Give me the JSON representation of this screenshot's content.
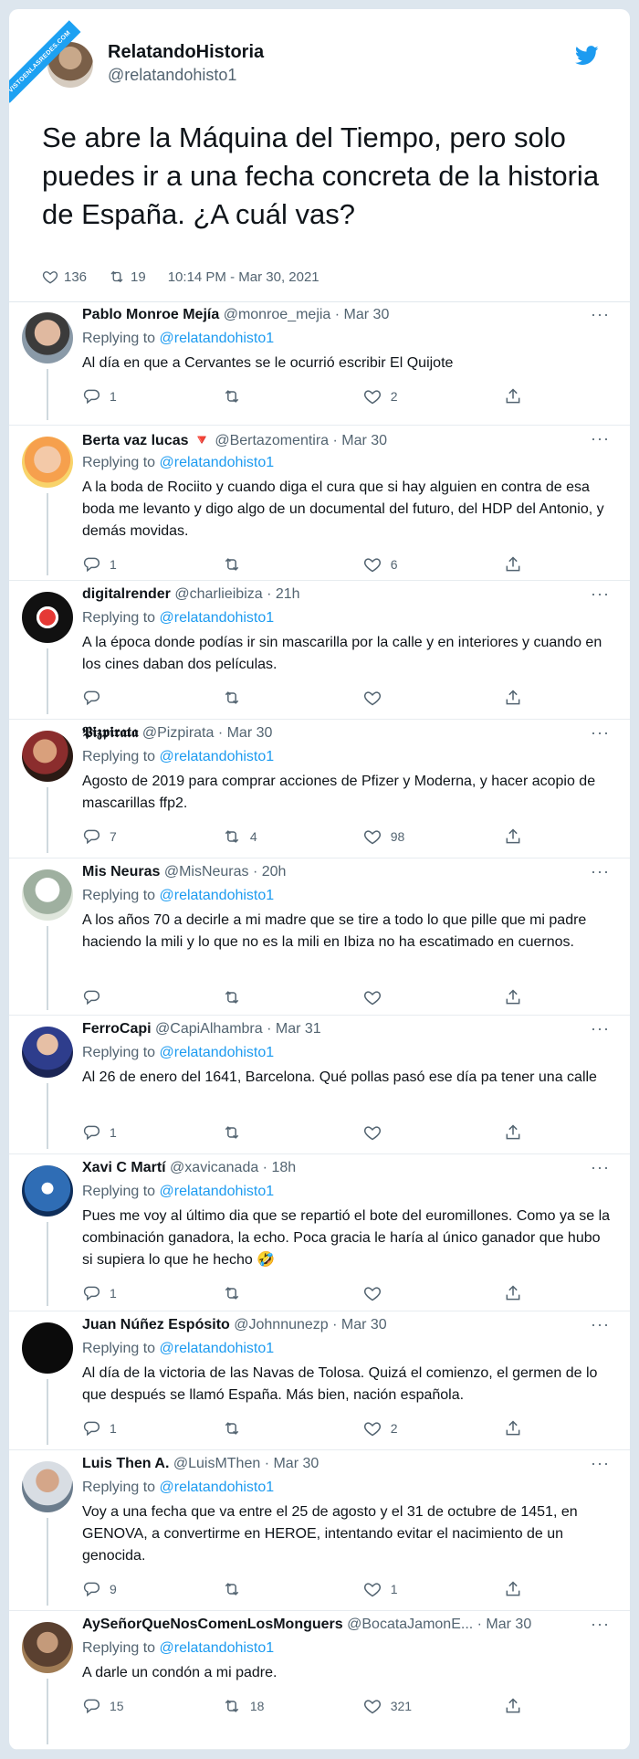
{
  "watermark": "VISTOENLASREDES.COM",
  "tweet": {
    "author_name": "RelatandoHistoria",
    "author_handle": "@relatandohisto1",
    "text": "Se abre la Máquina del Tiempo, pero solo puedes ir a una fecha concreta de la historia de España. ¿A cuál vas?",
    "likes": "136",
    "retweets": "19",
    "timestamp": "10:14 PM - Mar 30, 2021"
  },
  "replies": [
    {
      "name": "Pablo Monroe Mejía",
      "handle": "@monroe_mejia · Mar 30",
      "replying_label": "Replying to ",
      "replying_to": "@relatandohisto1",
      "text": "Al día en que a Cervantes se le ocurrió escribir El Quijote",
      "reply_count": "1",
      "retweet_count": "",
      "like_count": "2"
    },
    {
      "name": "Berta vaz lucas 🔻",
      "handle": "@Bertazomentira · Mar 30",
      "replying_label": "Replying to ",
      "replying_to": "@relatandohisto1",
      "text": "A la boda de Rociito y cuando diga el cura que si hay alguien en contra de esa boda me levanto y digo algo de un documental del futuro, del HDP del Antonio, y demás movidas.",
      "reply_count": "1",
      "retweet_count": "",
      "like_count": "6"
    },
    {
      "name": "digitalrender",
      "handle": "@charlieibiza · 21h",
      "replying_label": "Replying to ",
      "replying_to": "@relatandohisto1",
      "text": "A la época donde podías ir sin mascarilla por la calle y en interiores y cuando en los cines daban dos películas.",
      "reply_count": "",
      "retweet_count": "",
      "like_count": ""
    },
    {
      "name": "𝕻𝖎𝖟𝖕𝖎𝖗𝖆𝖙𝖆",
      "handle": "@Pizpirata · Mar 30",
      "replying_label": "Replying to ",
      "replying_to": "@relatandohisto1",
      "text": "Agosto de 2019 para comprar acciones de Pfizer y Moderna, y hacer acopio de mascarillas ffp2.",
      "reply_count": "7",
      "retweet_count": "4",
      "like_count": "98"
    },
    {
      "name": "Mis Neuras",
      "handle": "@MisNeuras · 20h",
      "replying_label": "Replying to ",
      "replying_to": "@relatandohisto1",
      "text": "A los años 70 a decirle a mi madre que se tire a todo lo que pille que mi padre haciendo la mili y lo que no es la mili en Ibiza no ha escatimado en cuernos.",
      "reply_count": "",
      "retweet_count": "",
      "like_count": ""
    },
    {
      "name": "FerroCapi",
      "handle": "@CapiAlhambra · Mar 31",
      "replying_label": "Replying to ",
      "replying_to": "@relatandohisto1",
      "text": "Al 26 de enero del 1641, Barcelona. Qué pollas pasó ese día pa tener una calle",
      "reply_count": "1",
      "retweet_count": "",
      "like_count": ""
    },
    {
      "name": "Xavi C Martí",
      "handle": "@xavicanada · 18h",
      "replying_label": "Replying to ",
      "replying_to": "@relatandohisto1",
      "text": "Pues me voy al último dia que se repartió el bote del euromillones. Como ya se la combinación ganadora, la echo. Poca gracia le haría al único ganador que hubo si supiera lo que he hecho 🤣",
      "reply_count": "1",
      "retweet_count": "",
      "like_count": ""
    },
    {
      "name": "Juan Núñez Espósito",
      "handle": "@Johnnunezp · Mar 30",
      "replying_label": "Replying to ",
      "replying_to": "@relatandohisto1",
      "text": "Al día de la victoria de las Navas de Tolosa. Quizá el comienzo, el germen de lo que después se llamó España. Más bien, nación española.",
      "reply_count": "1",
      "retweet_count": "",
      "like_count": "2"
    },
    {
      "name": "Luis Then A.",
      "handle": "@LuisMThen · Mar 30",
      "replying_label": "Replying to ",
      "replying_to": "@relatandohisto1",
      "text": "Voy a una fecha que va entre el 25 de agosto y el 31 de octubre de 1451, en GENOVA, a convertirme en HEROE, intentando evitar el nacimiento de un genocida.",
      "reply_count": "9",
      "retweet_count": "",
      "like_count": "1"
    },
    {
      "name": "AySeñorQueNosComenLosMonguers",
      "handle": "@BocataJamonE... · Mar 30",
      "replying_label": "Replying to ",
      "replying_to": "@relatandohisto1",
      "text": "A darle un condón a mi padre.",
      "reply_count": "15",
      "retweet_count": "18",
      "like_count": "321"
    }
  ],
  "icons": {
    "more": "more-horizontal-icon",
    "reply": "reply-icon",
    "retweet": "retweet-icon",
    "like": "heart-icon",
    "share": "share-icon",
    "brand": "twitter-bird-icon"
  },
  "colors": {
    "accent": "#1d9bf0",
    "muted": "#536471"
  }
}
